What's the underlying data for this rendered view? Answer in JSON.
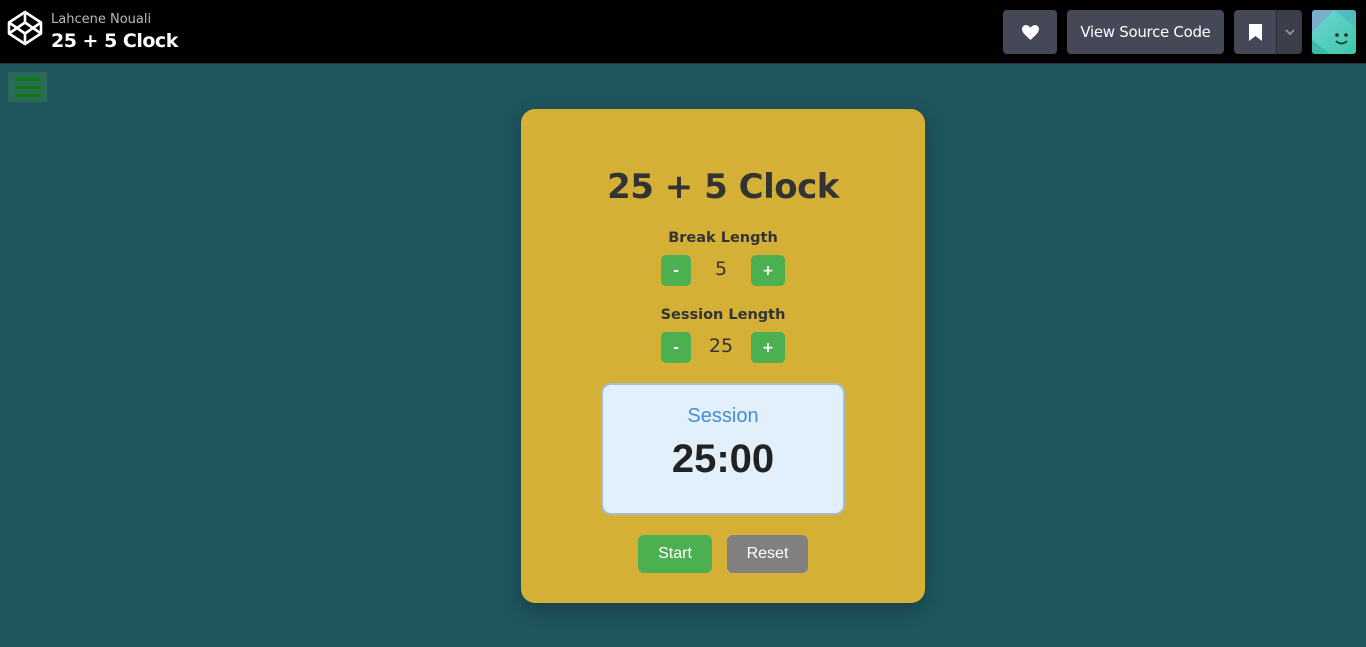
{
  "header": {
    "author": "Lahcene Nouali",
    "pen_title": "25 + 5 Clock",
    "view_source_label": "View Source Code",
    "icons": {
      "logo": "codepen-logo-icon",
      "heart": "heart-icon",
      "bookmark": "bookmark-icon",
      "dropdown": "chevron-down-icon",
      "avatar": "user-avatar-icon"
    }
  },
  "clock": {
    "title": "25 + 5 Clock",
    "break": {
      "label": "Break Length",
      "decrement": "-",
      "value": "5",
      "increment": "+"
    },
    "session": {
      "label": "Session Length",
      "decrement": "-",
      "value": "25",
      "increment": "+"
    },
    "timer": {
      "label": "Session",
      "time": "25:00"
    },
    "start_label": "Start",
    "reset_label": "Reset"
  },
  "colors": {
    "page_bg": "#1f555d",
    "card_bg": "#d4b036",
    "accent_green": "#4caf50",
    "reset_gray": "#808080",
    "timer_bg": "#e2f0fc",
    "timer_label": "#4a8bd0"
  }
}
